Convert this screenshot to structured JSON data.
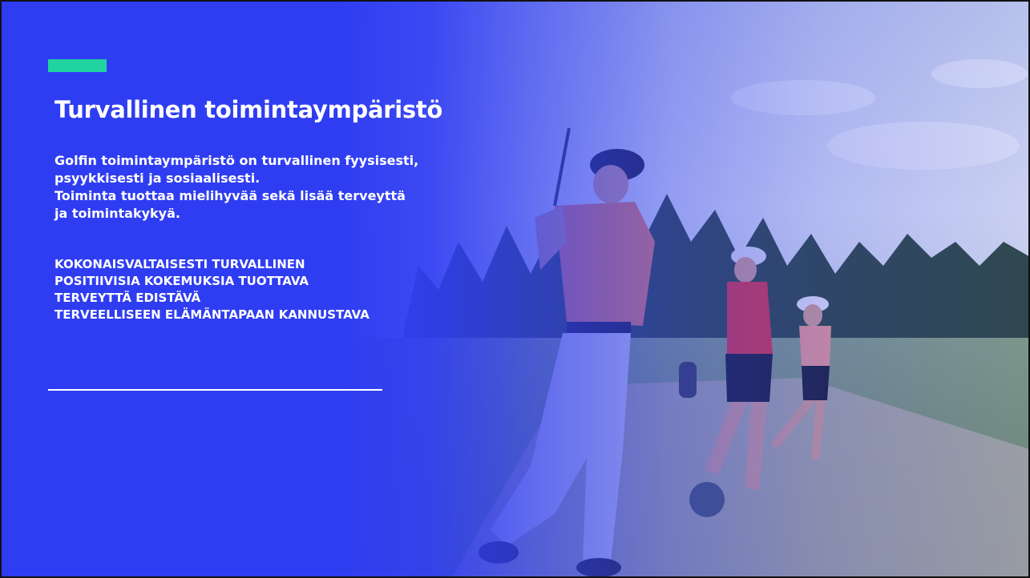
{
  "slide": {
    "title": "Turvallinen toimintaympäristö",
    "intro_lines": [
      "Golfin toimintaympäristö on turvallinen fyysisesti,",
      "psyykkisesti ja sosiaalisesti.",
      "Toiminta tuottaa mielihyvää sekä lisää terveyttä",
      "ja toimintakykyä."
    ],
    "bullets": [
      "KOKONAISVALTAISESTI TURVALLINEN",
      "POSITIIVISIA KOKEMUKSIA TUOTTAVA",
      "TERVEYTTÄ EDISTÄVÄ",
      "TERVEELLISEEN ELÄMÄNTAPAAN KANNUSTAVA"
    ]
  },
  "colors": {
    "background_blue": "#2f3df2",
    "accent_green": "#20d3a0",
    "text": "#ffffff"
  },
  "background_image": "golfers-on-driving-range-photo"
}
